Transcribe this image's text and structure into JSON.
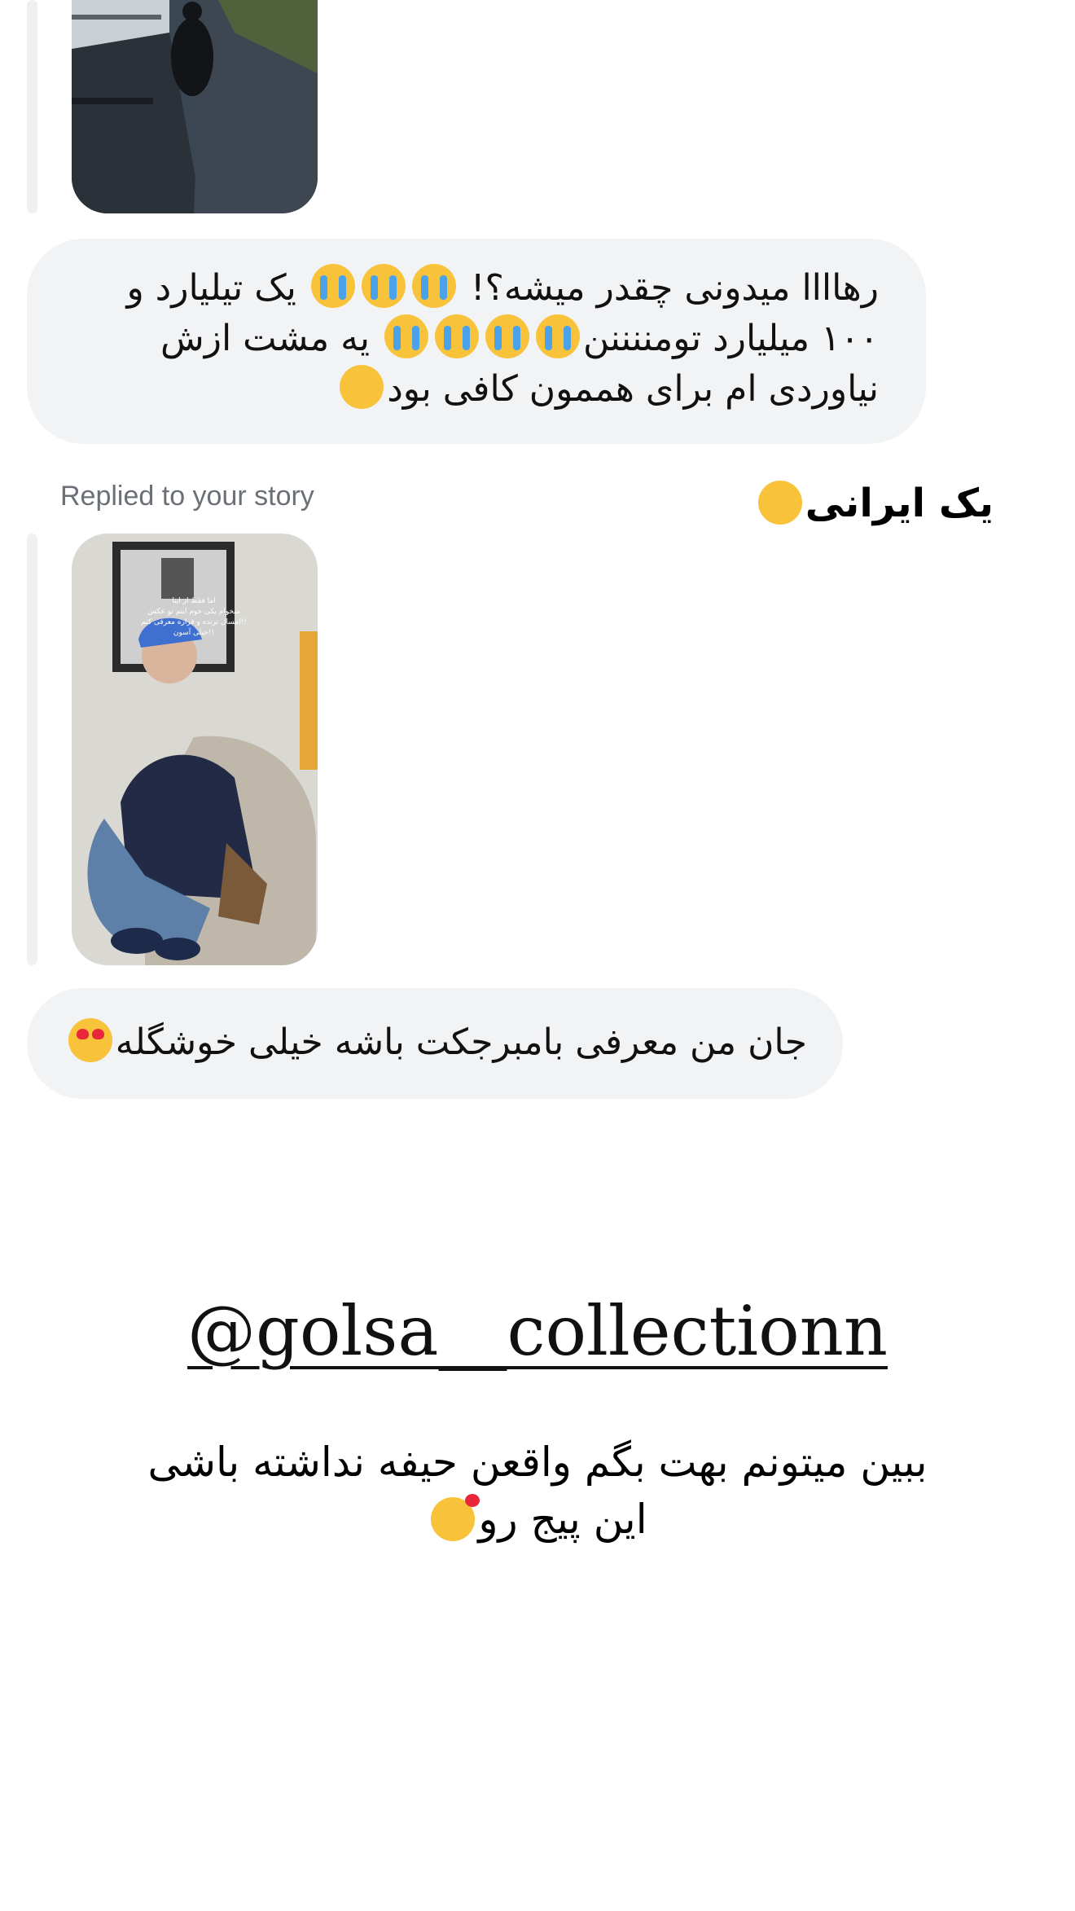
{
  "thread": {
    "message1": {
      "part1": "رهاااا میدونی چقدر میشه؟!",
      "part2": "یک تیلیارد و ۱۰۰ میلیارد تومننننن",
      "part3": "یه مشت ازش نیاوردی ام برای هممون کافی بود",
      "emojis": [
        "loudly-crying-face-icon",
        "rolling-on-floor-laughing-icon"
      ]
    },
    "replied_label": "Replied to your story",
    "story_caption": "یک ایرانی",
    "story_caption_emoji": "face-with-tears-of-joy-icon",
    "story_overlay_lines": [
      "اما فقط از اینا",
      "میخوام یکی خوم ابتم تو عکس",
      "امسال نرنده و قراره معرفی کنم!!",
      "خیلی آسون!!"
    ],
    "message2": {
      "text": "جان من معرفی بامبرجکت باشه خیلی خوشگله",
      "emoji": "smiling-face-with-heart-eyes-icon"
    }
  },
  "promo": {
    "handle": "@golsa__collectionn",
    "text": "ببین میتونم بهت بگم واقعن حیفه نداشته باشی این پیج رو",
    "emoji": "smiling-face-with-hearts-icon"
  },
  "colors": {
    "bubble_bg": "#f2f3f5",
    "quote_bar": "#eef0f2",
    "secondary_text": "#6b6f76"
  }
}
